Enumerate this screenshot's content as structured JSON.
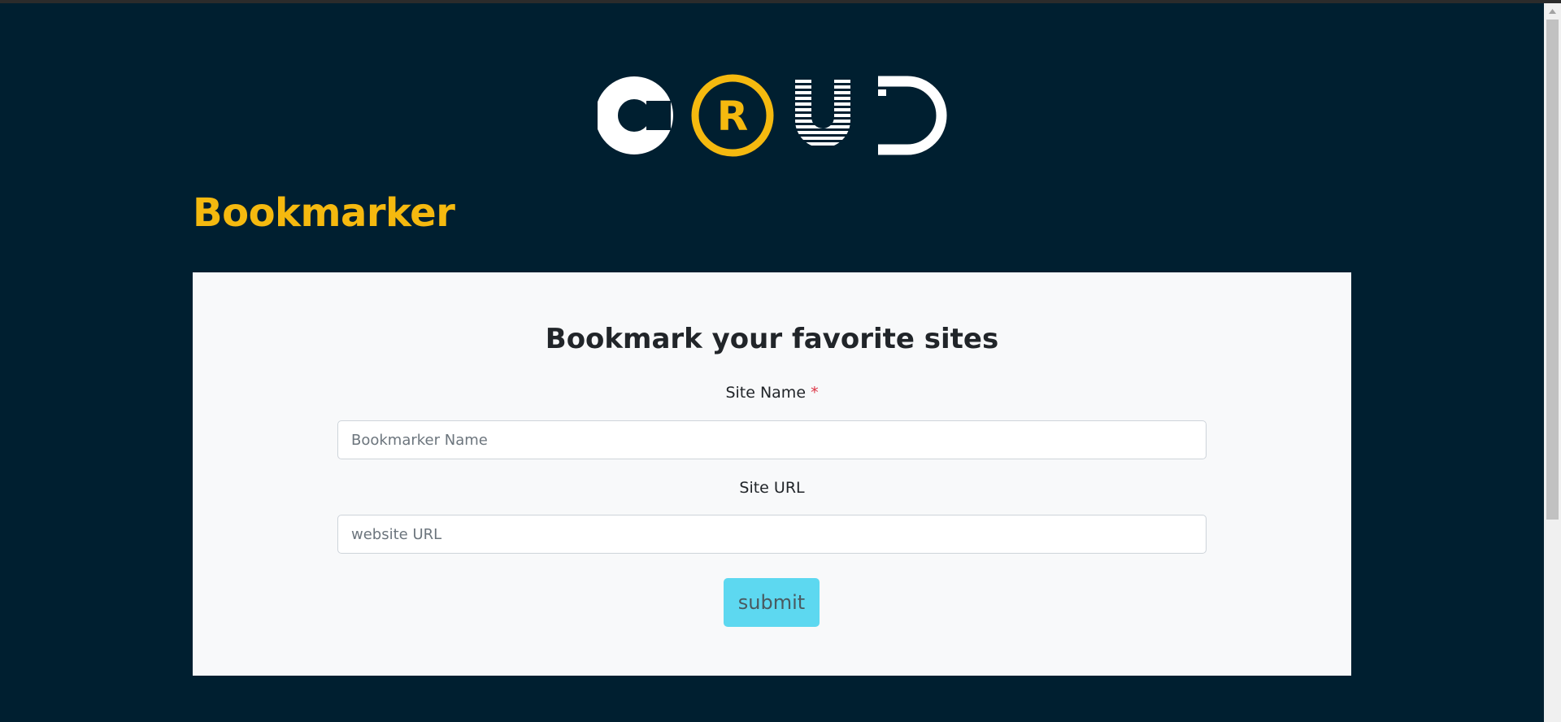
{
  "logo": {
    "letters": [
      "C",
      "R",
      "U",
      "D"
    ],
    "accent_color": "#f5b90f",
    "icon": "crud-logo-icon"
  },
  "app": {
    "title": "Bookmarker"
  },
  "form": {
    "heading": "Bookmark your favorite sites",
    "site_name_label": "Site Name",
    "required_marker": "*",
    "site_name_placeholder": "Bookmarker Name",
    "site_name_value": "",
    "site_url_label": "Site URL",
    "site_url_placeholder": "website URL",
    "site_url_value": "",
    "submit_label": "submit"
  },
  "colors": {
    "background": "#001f30",
    "accent": "#f5b90f",
    "card": "#f8f9fa",
    "button": "#5dd8f0",
    "required": "#dc3545"
  }
}
